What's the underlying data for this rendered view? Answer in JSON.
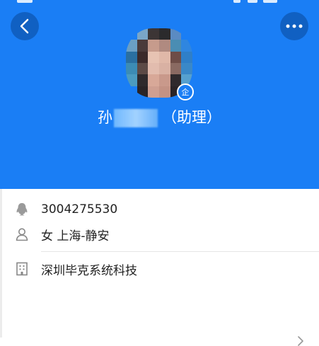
{
  "profile": {
    "name_visible": "孙",
    "role": "（助理）",
    "badge_label": "企"
  },
  "info": {
    "qq_number": "3004275530",
    "gender_location": "女 上海-静安",
    "company": "深圳毕克系统科技"
  },
  "icons": {
    "back": "chevron-left-icon",
    "more": "more-dots-icon",
    "qq": "qq-penguin-icon",
    "person": "person-icon",
    "company": "building-icon",
    "chevron": "chevron-right-icon"
  },
  "colors": {
    "header_bg": "#1a7ef5",
    "text": "#222222",
    "icon": "#888888"
  }
}
